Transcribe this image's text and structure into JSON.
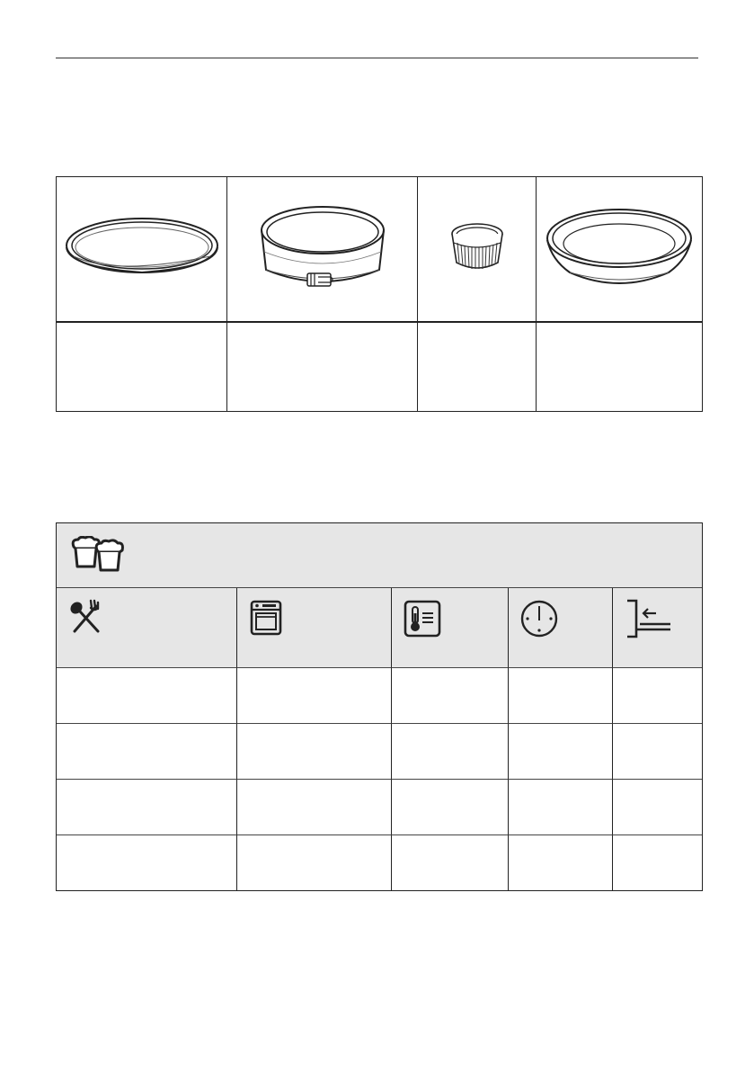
{
  "bakeware": {
    "items": [
      {
        "icon": "flat-tart-tin-icon",
        "label": ""
      },
      {
        "icon": "springform-cake-tin-icon",
        "label": ""
      },
      {
        "icon": "ramekin-icon",
        "label": ""
      },
      {
        "icon": "flan-tin-icon",
        "label": ""
      }
    ]
  },
  "baking_table": {
    "category_icon": "muffins-icon",
    "columns": [
      {
        "icon": "spoon-fork-icon",
        "label": ""
      },
      {
        "icon": "oven-function-icon",
        "label": ""
      },
      {
        "icon": "thermometer-icon",
        "label": ""
      },
      {
        "icon": "clock-icon",
        "label": ""
      },
      {
        "icon": "shelf-position-icon",
        "label": ""
      }
    ],
    "rows": [
      [
        "",
        "",
        "",
        "",
        ""
      ],
      [
        "",
        "",
        "",
        "",
        ""
      ],
      [
        "",
        "",
        "",
        "",
        ""
      ],
      [
        "",
        "",
        "",
        "",
        ""
      ]
    ]
  }
}
